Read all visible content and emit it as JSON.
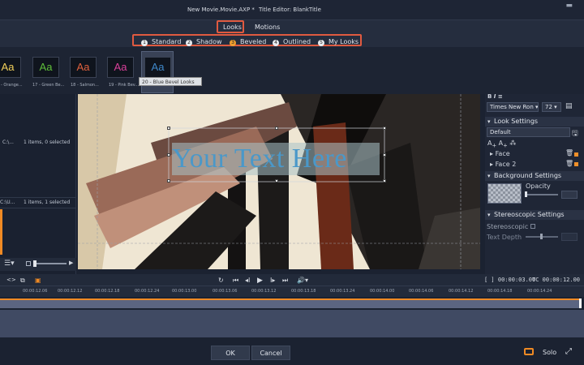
{
  "window": {
    "project_title": "New Movie.Movie.AXP *",
    "editor_title": "Title Editor: BlankTitle"
  },
  "tabs": [
    {
      "label": "Looks",
      "active": true
    },
    {
      "label": "Motions",
      "active": false
    }
  ],
  "look_categories": [
    {
      "num": "1",
      "label": "Standard",
      "selected": false
    },
    {
      "num": "2",
      "label": "Shadow",
      "selected": false
    },
    {
      "num": "3",
      "label": "Beveled",
      "selected": true
    },
    {
      "num": "4",
      "label": "Outlined",
      "selected": false
    },
    {
      "num": "5",
      "label": "My Looks",
      "selected": false
    }
  ],
  "looks": [
    {
      "glyph": "Aa",
      "caption": "- Orange...",
      "color": "#f2d05a"
    },
    {
      "glyph": "Aa",
      "caption": "17 - Green Be...",
      "color": "#5fbf3a"
    },
    {
      "glyph": "Aa",
      "caption": "18 - Salmon...",
      "color": "#e0613d"
    },
    {
      "glyph": "Aa",
      "caption": "19 - Pink Bev...",
      "color": "#d9409a"
    },
    {
      "glyph": "Aa",
      "caption": "20 - Blue Bev...",
      "color": "#3f87c8"
    }
  ],
  "tooltip": "20 - Blue Bevel Looks",
  "left_panel": {
    "row1_path": "C:\\...",
    "row1_status": "1 items, 0 selected",
    "row2_path": "C:\\U...",
    "row2_status": "1 items, 1 selected"
  },
  "canvas": {
    "title_text": "Your Text Here"
  },
  "right_panel": {
    "font": "Times New Ron",
    "size": "72",
    "look_settings": {
      "header": "Look Settings",
      "preset": "Default",
      "layers": [
        "Face",
        "Face 2"
      ]
    },
    "background_settings": {
      "header": "Background Settings",
      "opacity_label": "Opacity"
    },
    "stereoscopic_settings": {
      "header": "Stereoscopic Settings",
      "stereoscopic_label": "Stereoscopic",
      "text_depth_label": "Text Depth"
    }
  },
  "transport": {
    "duration": "00:00:03.00",
    "position": "00:00:12.00",
    "duration_prefix": "[ ]",
    "position_prefix": "TC"
  },
  "ruler_ticks": [
    "00:00:12.06",
    "00:00:12.12",
    "00:00:12.18",
    "00:00:12.24",
    "00:00:13.00",
    "00:00:13.06",
    "00:00:13.12",
    "00:00:13.18",
    "00:00:13.24",
    "00:00:14.00",
    "00:00:14.06",
    "00:00:14.12",
    "00:00:14.18",
    "00:00:14.24"
  ],
  "footer": {
    "ok": "OK",
    "cancel": "Cancel",
    "solo": "Solo"
  },
  "colors": {
    "accent_orange": "#f08a24",
    "highlight_red": "#e05a40",
    "title_text_blue": "#4a98c9"
  }
}
